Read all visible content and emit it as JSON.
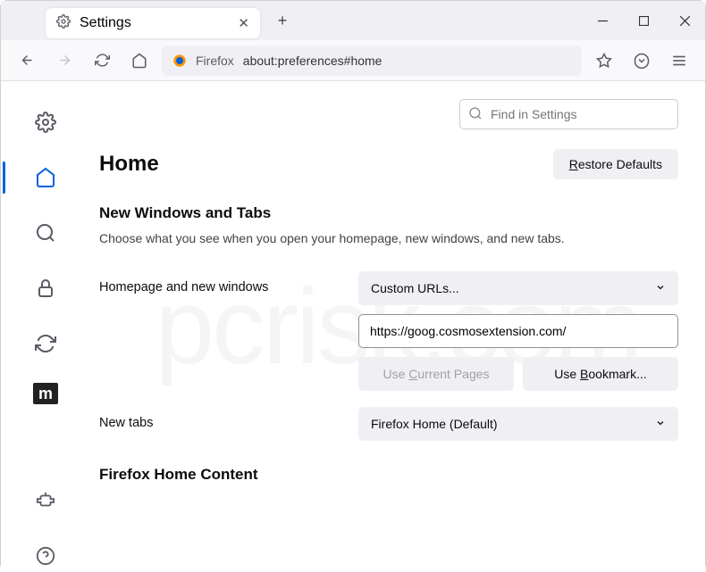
{
  "tab": {
    "title": "Settings"
  },
  "urlbar": {
    "product": "Firefox",
    "url": "about:preferences#home"
  },
  "search": {
    "placeholder": "Find in Settings"
  },
  "page": {
    "title": "Home",
    "restore": "Restore Defaults"
  },
  "newwin": {
    "title": "New Windows and Tabs",
    "desc": "Choose what you see when you open your homepage, new windows, and new tabs."
  },
  "homepage": {
    "label": "Homepage and new windows",
    "select": "Custom URLs...",
    "url": "https://goog.cosmosextension.com/",
    "useCurrent": "Use Current Pages",
    "useBookmark": "Use Bookmark..."
  },
  "newtabs": {
    "label": "New tabs",
    "select": "Firefox Home (Default)"
  },
  "homecontent": {
    "title": "Firefox Home Content"
  },
  "watermark": "pcrisk.com"
}
